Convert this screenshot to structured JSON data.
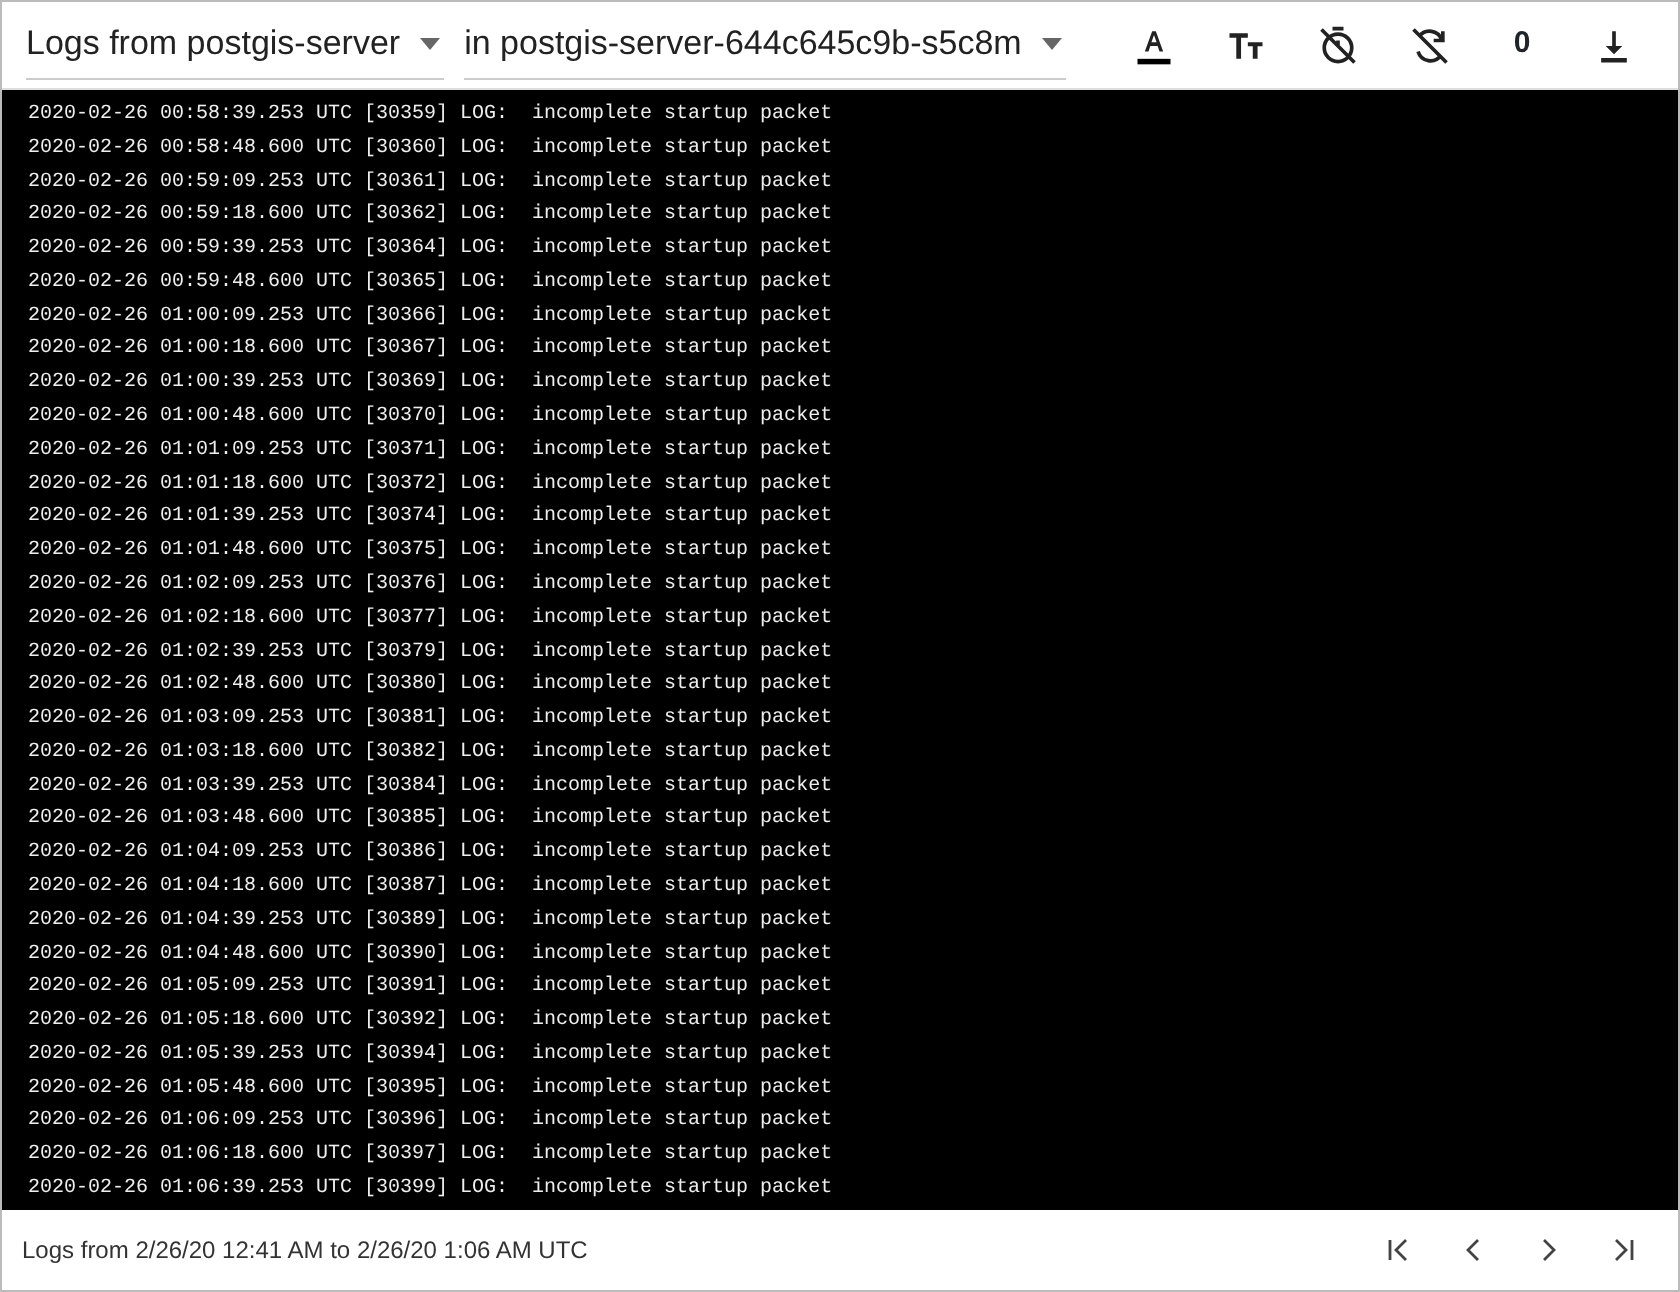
{
  "toolbar": {
    "pod_select": "Logs from postgis-server",
    "container_select": "in postgis-server-644c645c9b-s5c8m",
    "counter": "0"
  },
  "log_lines": [
    "2020-02-26 00:58:39.253 UTC [30359] LOG:  incomplete startup packet",
    "2020-02-26 00:58:48.600 UTC [30360] LOG:  incomplete startup packet",
    "2020-02-26 00:59:09.253 UTC [30361] LOG:  incomplete startup packet",
    "2020-02-26 00:59:18.600 UTC [30362] LOG:  incomplete startup packet",
    "2020-02-26 00:59:39.253 UTC [30364] LOG:  incomplete startup packet",
    "2020-02-26 00:59:48.600 UTC [30365] LOG:  incomplete startup packet",
    "2020-02-26 01:00:09.253 UTC [30366] LOG:  incomplete startup packet",
    "2020-02-26 01:00:18.600 UTC [30367] LOG:  incomplete startup packet",
    "2020-02-26 01:00:39.253 UTC [30369] LOG:  incomplete startup packet",
    "2020-02-26 01:00:48.600 UTC [30370] LOG:  incomplete startup packet",
    "2020-02-26 01:01:09.253 UTC [30371] LOG:  incomplete startup packet",
    "2020-02-26 01:01:18.600 UTC [30372] LOG:  incomplete startup packet",
    "2020-02-26 01:01:39.253 UTC [30374] LOG:  incomplete startup packet",
    "2020-02-26 01:01:48.600 UTC [30375] LOG:  incomplete startup packet",
    "2020-02-26 01:02:09.253 UTC [30376] LOG:  incomplete startup packet",
    "2020-02-26 01:02:18.600 UTC [30377] LOG:  incomplete startup packet",
    "2020-02-26 01:02:39.253 UTC [30379] LOG:  incomplete startup packet",
    "2020-02-26 01:02:48.600 UTC [30380] LOG:  incomplete startup packet",
    "2020-02-26 01:03:09.253 UTC [30381] LOG:  incomplete startup packet",
    "2020-02-26 01:03:18.600 UTC [30382] LOG:  incomplete startup packet",
    "2020-02-26 01:03:39.253 UTC [30384] LOG:  incomplete startup packet",
    "2020-02-26 01:03:48.600 UTC [30385] LOG:  incomplete startup packet",
    "2020-02-26 01:04:09.253 UTC [30386] LOG:  incomplete startup packet",
    "2020-02-26 01:04:18.600 UTC [30387] LOG:  incomplete startup packet",
    "2020-02-26 01:04:39.253 UTC [30389] LOG:  incomplete startup packet",
    "2020-02-26 01:04:48.600 UTC [30390] LOG:  incomplete startup packet",
    "2020-02-26 01:05:09.253 UTC [30391] LOG:  incomplete startup packet",
    "2020-02-26 01:05:18.600 UTC [30392] LOG:  incomplete startup packet",
    "2020-02-26 01:05:39.253 UTC [30394] LOG:  incomplete startup packet",
    "2020-02-26 01:05:48.600 UTC [30395] LOG:  incomplete startup packet",
    "2020-02-26 01:06:09.253 UTC [30396] LOG:  incomplete startup packet",
    "2020-02-26 01:06:18.600 UTC [30397] LOG:  incomplete startup packet",
    "2020-02-26 01:06:39.253 UTC [30399] LOG:  incomplete startup packet"
  ],
  "footer": {
    "range_text": "Logs from 2/26/20 12:41 AM to 2/26/20 1:06 AM UTC"
  }
}
